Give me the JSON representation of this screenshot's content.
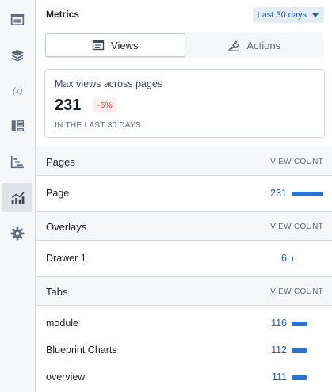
{
  "rail": {
    "items": [
      {
        "icon": "panel-stats-icon",
        "active": false
      },
      {
        "icon": "layers-icon",
        "active": false
      },
      {
        "icon": "variable-icon",
        "label": "(x)",
        "active": false
      },
      {
        "icon": "list-columns-icon",
        "active": false
      },
      {
        "icon": "timeline-bar-chart-icon",
        "active": false
      },
      {
        "icon": "trending-up-chart-icon",
        "active": true
      },
      {
        "icon": "gear-icon",
        "active": false
      }
    ]
  },
  "header": {
    "title": "Metrics",
    "range": "Last 30 days"
  },
  "tabs": [
    {
      "label": "Views",
      "icon": "panel-icon",
      "selected": true
    },
    {
      "label": "Actions",
      "icon": "hand-pointer-icon",
      "selected": false
    }
  ],
  "summary": {
    "title": "Max views across pages",
    "value": "231",
    "delta": "-6%",
    "note": "IN THE LAST 30 DAYS"
  },
  "column_label": "VIEW COUNT",
  "sections": [
    {
      "name": "Pages",
      "rows": [
        {
          "label": "Page",
          "count": 231
        }
      ]
    },
    {
      "name": "Overlays",
      "rows": [
        {
          "label": "Drawer 1",
          "count": 6
        }
      ]
    },
    {
      "name": "Tabs",
      "rows": [
        {
          "label": "module",
          "count": 116
        },
        {
          "label": "Blueprint Charts",
          "count": 112
        },
        {
          "label": "overview",
          "count": 111
        }
      ]
    }
  ],
  "colors": {
    "accent": "#2d72d2",
    "link": "#215db0",
    "negative": "#cd4246"
  }
}
